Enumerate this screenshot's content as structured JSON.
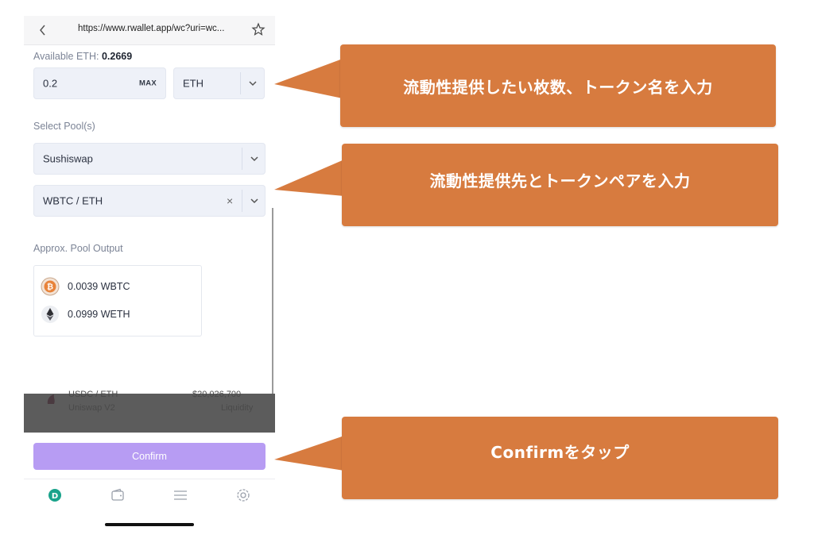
{
  "browser": {
    "url": "https://www.rwallet.app/wc?uri=wc..."
  },
  "form": {
    "available_label": "Available ETH:",
    "available_value": "0.2669",
    "amount_value": "0.2",
    "max_label": "MAX",
    "token_value": "ETH",
    "select_pools_label": "Select Pool(s)",
    "pool_value": "Sushiswap",
    "pair_value": "WBTC / ETH",
    "clear_symbol": "×",
    "output_label": "Approx. Pool Output",
    "outputs": [
      {
        "amount": "0.0039 WBTC",
        "icon": "bitcoin-icon"
      },
      {
        "amount": "0.0999 WETH",
        "icon": "ethereum-icon"
      }
    ]
  },
  "background_list": {
    "name": "Uniswap V2",
    "value_label": "Liquidity",
    "value": "$20,026,700",
    "pair": "USDC / ETH"
  },
  "confirm_label": "Confirm",
  "tabs": [
    {
      "icon": "dapp-icon"
    },
    {
      "icon": "wallet-icon"
    },
    {
      "icon": "menu-icon"
    },
    {
      "icon": "settings-icon"
    }
  ],
  "callouts": {
    "amount_token": "流動性提供したい枚数、トークン名を入力",
    "pool_pair": "流動性提供先とトークンペアを入力",
    "confirm": "Confirmをタップ"
  },
  "colors": {
    "callout": "#d77b3f",
    "confirm_button": "#b79cf3",
    "field_bg": "#eef1f8",
    "active_tab": "#1aa38b"
  }
}
